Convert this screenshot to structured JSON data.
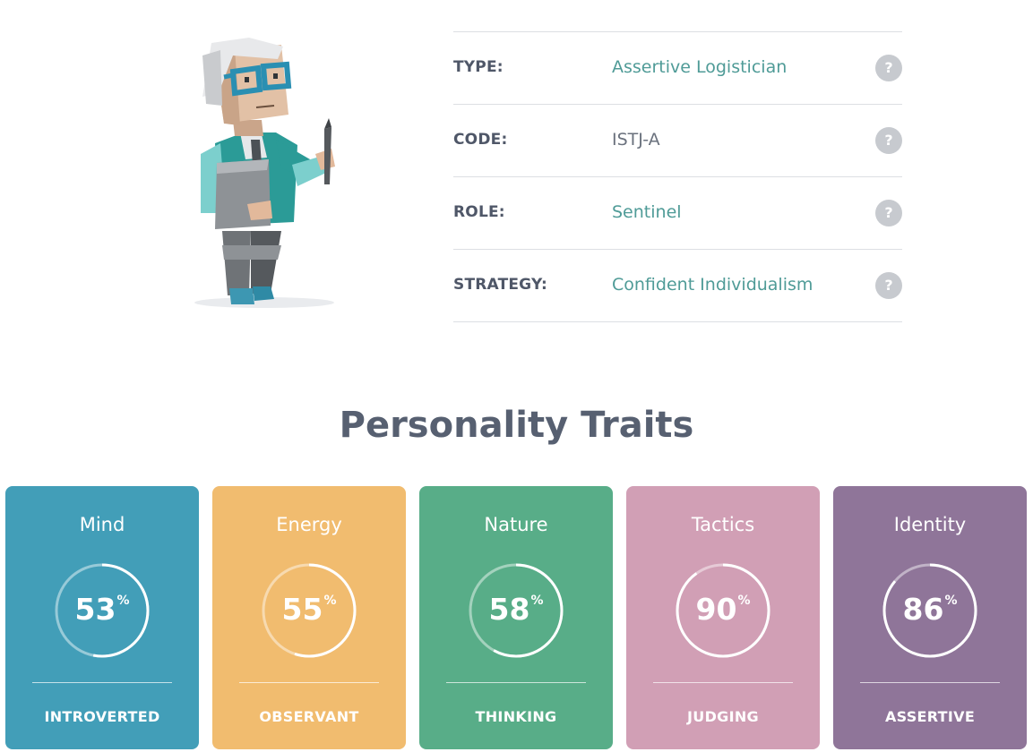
{
  "profile": {
    "rows": [
      {
        "label": "TYPE:",
        "value": "Assertive Logistician",
        "accent": true,
        "help": "?"
      },
      {
        "label": "CODE:",
        "value": "ISTJ-A",
        "accent": false,
        "help": "?"
      },
      {
        "label": "ROLE:",
        "value": "Sentinel",
        "accent": true,
        "help": "?"
      },
      {
        "label": "STRATEGY:",
        "value": "Confident Individualism",
        "accent": true,
        "help": "?"
      }
    ]
  },
  "traits_title": "Personality Traits",
  "traits": [
    {
      "name": "Mind",
      "percent": 53,
      "percent_sign": "%",
      "trait": "INTROVERTED",
      "color": "#429eb8"
    },
    {
      "name": "Energy",
      "percent": 55,
      "percent_sign": "%",
      "trait": "OBSERVANT",
      "color": "#f1bc6f"
    },
    {
      "name": "Nature",
      "percent": 58,
      "percent_sign": "%",
      "trait": "THINKING",
      "color": "#58ad88"
    },
    {
      "name": "Tactics",
      "percent": 90,
      "percent_sign": "%",
      "trait": "JUDGING",
      "color": "#d19fb5"
    },
    {
      "name": "Identity",
      "percent": 86,
      "percent_sign": "%",
      "trait": "ASSERTIVE",
      "color": "#8f7599"
    }
  ],
  "icons": {
    "avatar": "logistician-avatar-illustration",
    "help": "question-mark-icon"
  }
}
